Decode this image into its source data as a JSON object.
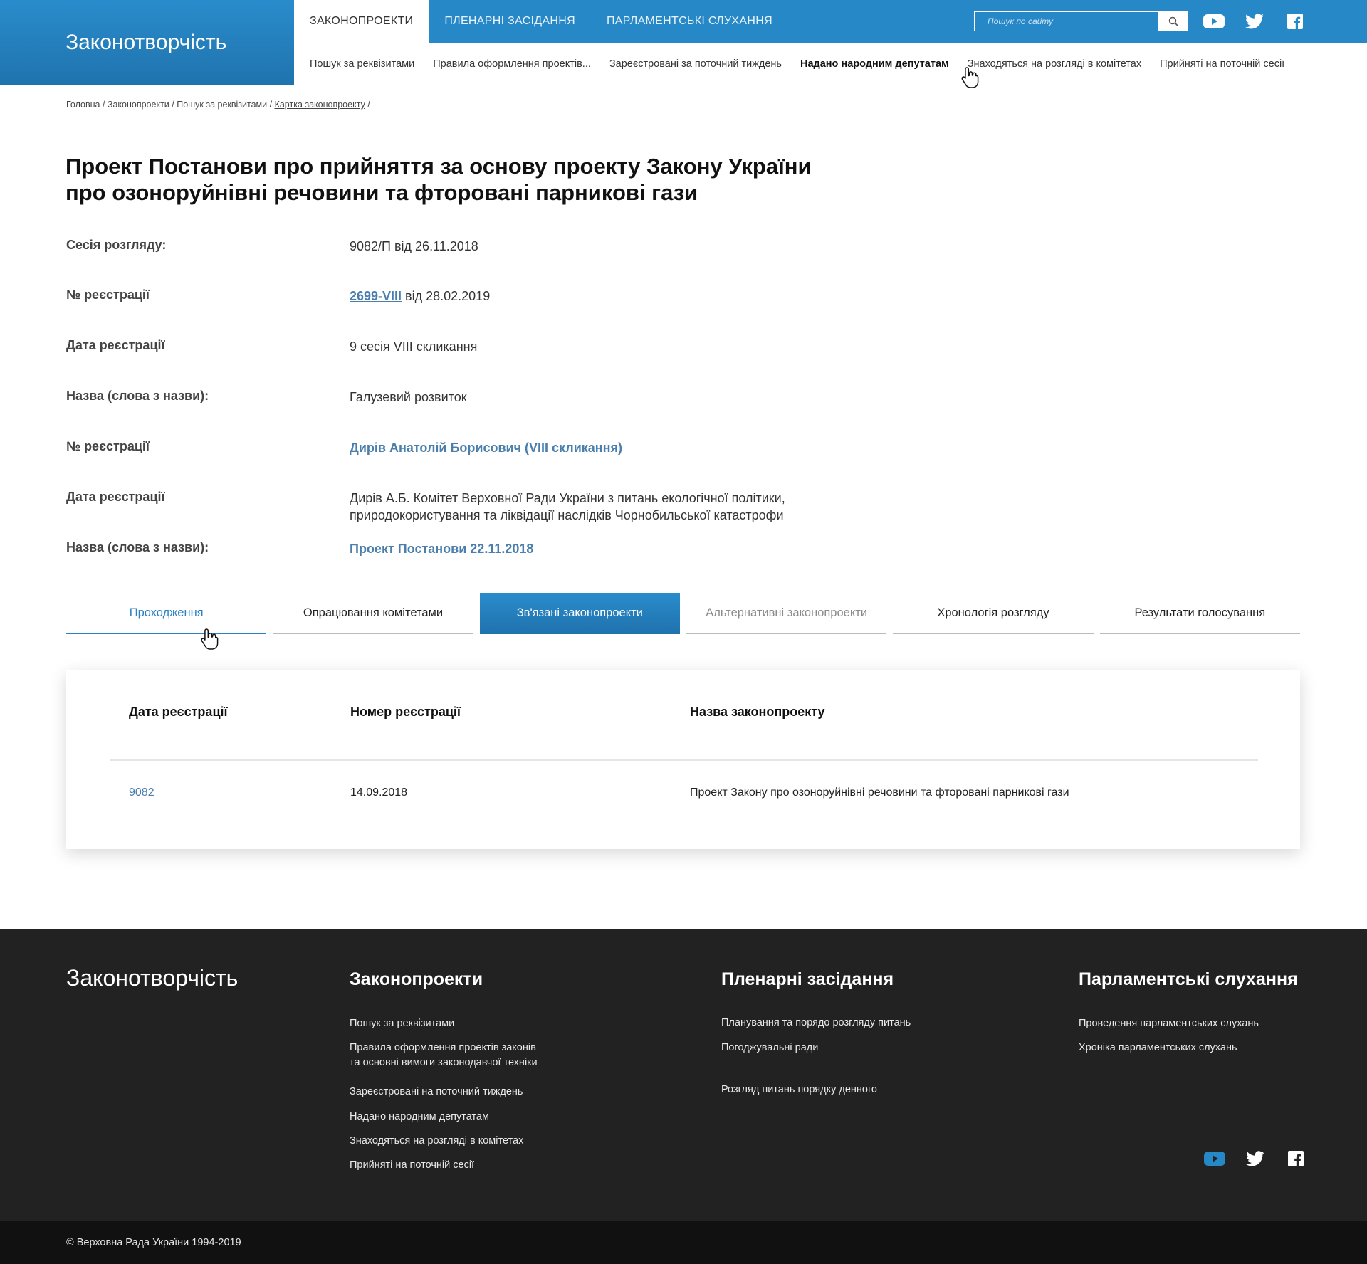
{
  "header": {
    "brand": "Законотворчість",
    "top_tabs": [
      "Законопроекти",
      "Пленарні засідання",
      "Парламентські слухання"
    ],
    "search_placeholder": "Пошук по сайту",
    "sub_nav": [
      "Пошук за реквізитами",
      "Правила оформлення проектів...",
      "Зареєстровані за поточний тиждень",
      "Надано народним депутатам",
      "Знаходяться на розгляді в комітетах",
      "Прийняті на поточній сесії"
    ]
  },
  "breadcrumb": {
    "items": [
      "Головна",
      "Законопроекти",
      "Пошук за реквізитами"
    ],
    "current": "Картка законопроекту",
    "sep": " / "
  },
  "title": {
    "line1": "Проект Постанови про прийняття за основу проекту Закону України",
    "line2": "про озоноруйнівні речовини та фторовані парникові гази"
  },
  "details": [
    {
      "label": "Сесія розгляду:",
      "value": "9082/П від 26.11.2018"
    },
    {
      "label": "№ реєстрації",
      "link": "2699-VIII",
      "value": " від 28.02.2019"
    },
    {
      "label": "Дата реєстрації",
      "value": "9 сесія VIII скликання"
    },
    {
      "label": "Назва (слова з назви):",
      "value": "Галузевий розвиток"
    },
    {
      "label": "№ реєстрації",
      "link": "Дирів Анатолій Борисович (VIII скликання)"
    },
    {
      "label": "Дата реєстрації",
      "value_line1": "Дирів А.Б. Комітет Верховної Ради України з питань екологічної політики,",
      "value_line2": "природокористування та ліквідації наслідків Чорнобильської катастрофи"
    },
    {
      "label": "Назва (слова з назви):",
      "link": "Проект Постанови 22.11.2018"
    }
  ],
  "tabs": [
    "Проходження",
    "Опрацювання комітетами",
    "Зв'язані законопроекти",
    "Альтернативні законопроекти",
    "Хронологія розгляду",
    "Результати голосування"
  ],
  "table": {
    "headers": [
      "Дата реєстрації",
      "Номер реєстрації",
      "Назва законопроекту"
    ],
    "rows": [
      {
        "c1": "9082",
        "c2": "14.09.2018",
        "c3": "Проект Закону про озоноруйнівні речовини та фторовані парникові гази"
      }
    ]
  },
  "footer": {
    "brand": "Законотворчість",
    "col1": {
      "title": "Законопроекти",
      "links": [
        "Пошук за реквізитами",
        "Правила оформлення проектів законів",
        "та основні вимоги законодавчої техніки",
        "Зареєстровані на поточний тиждень",
        "Надано народним депутатам",
        "Знаходяться на розгляді в комітетах",
        "Прийняті на поточній сесії"
      ]
    },
    "col2": {
      "title": "Пленарні засідання",
      "links": [
        "Планування та порядо розгляду питань",
        "Погоджувальні ради",
        "Розгляд питань порядку денного"
      ]
    },
    "col3": {
      "title": "Парламентські слухання",
      "links": [
        "Проведення парламентських слухань",
        "Хроніка парламентських слухань"
      ]
    },
    "copyright": "© Верховна Рада України 1994-2019"
  },
  "icons": {
    "search": "search-icon",
    "youtube": "youtube-icon",
    "twitter": "twitter-icon",
    "facebook": "facebook-icon",
    "cursor": "hand-cursor-icon"
  },
  "colors": {
    "primary": "#2788c7",
    "primary_dark": "#1f73ad",
    "link": "#4a7fad",
    "footer_bg": "#222222",
    "bottom_bg": "#111111"
  }
}
